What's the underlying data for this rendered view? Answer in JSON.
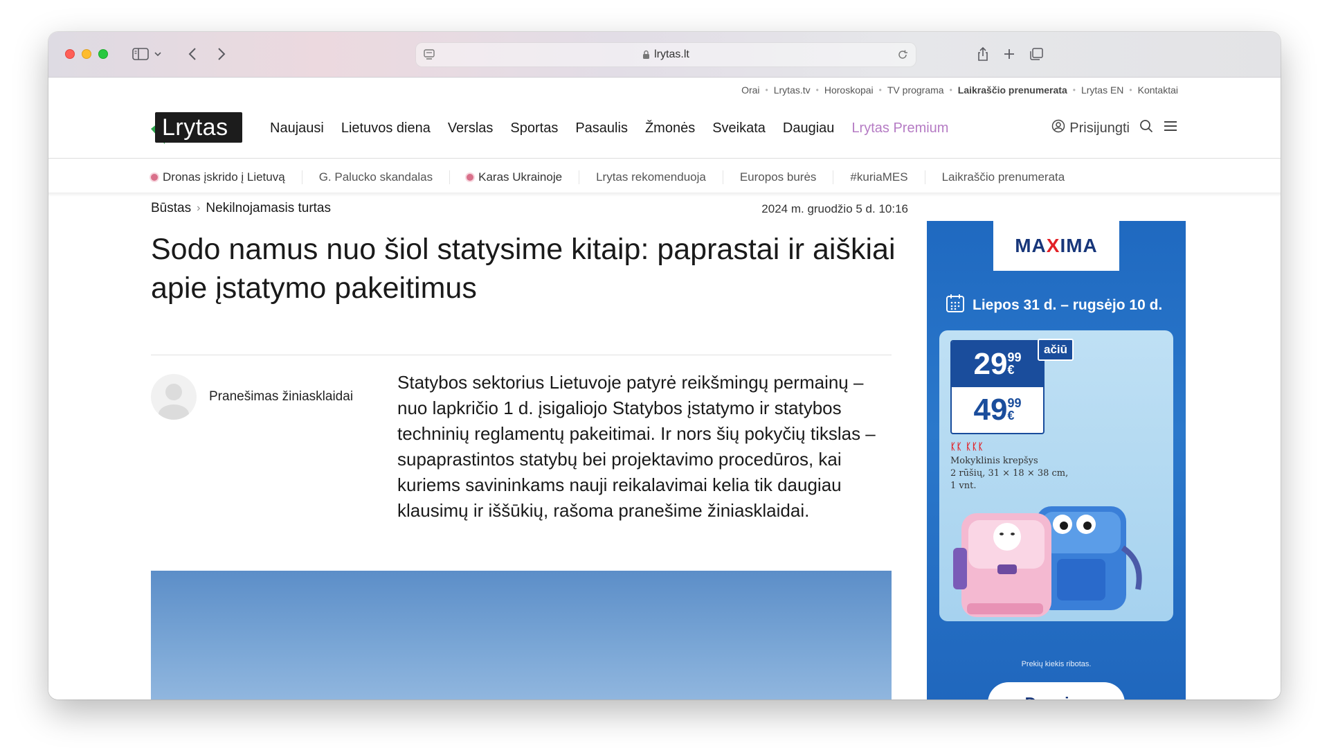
{
  "browser": {
    "url": "lrytas.lt"
  },
  "top_links": [
    "Orai",
    "Lrytas.tv",
    "Horoskopai",
    "TV programa",
    "Laikraščio prenumerata",
    "Lrytas EN",
    "Kontaktai"
  ],
  "logo": {
    "text": "Lrytas"
  },
  "main_nav": [
    "Naujausi",
    "Lietuvos diena",
    "Verslas",
    "Sportas",
    "Pasaulis",
    "Žmonės",
    "Sveikata",
    "Daugiau",
    "Lrytas Premium"
  ],
  "user": {
    "login_label": "Prisijungti"
  },
  "trending": [
    {
      "label": "Dronas įskrido į Lietuvą",
      "live": true
    },
    {
      "label": "G. Palucko skandalas",
      "live": false
    },
    {
      "label": "Karas Ukrainoje",
      "live": true
    },
    {
      "label": "Lrytas rekomenduoja",
      "live": false
    },
    {
      "label": "Europos burės",
      "live": false
    },
    {
      "label": "#kuriaMES",
      "live": false
    },
    {
      "label": "Laikraščio prenumerata",
      "live": false
    }
  ],
  "article": {
    "breadcrumb": [
      "Būstas",
      "Nekilnojamasis turtas"
    ],
    "date": "2024 m. gruodžio 5 d. 10:16",
    "headline": "Sodo namus nuo šiol statysime kitaip: paprastai ir aiškiai apie įstatymo pakeitimus",
    "author": "Pranešimas žiniasklaidai",
    "lead": "Statybos sektorius Lietuvoje patyrė reikšmingų permainų – nuo lapkričio 1 d. įsigaliojo Statybos įstatymo ir statybos techninių reglamentų pakeitimai. Ir nors šių pokyčių tikslas – supaprastintos statybų bei projektavimo procedūros, kai kuriems savininkams nauji reikalavimai kelia tik daugiau klausimų ir iššūkių, rašoma pranešime žiniasklaidai."
  },
  "ad": {
    "brand_left": "MA",
    "brand_x": "X",
    "brand_right": "IMA",
    "dates": "Liepos 31 d. – rugsėjo 10 d.",
    "price_new_main": "29",
    "price_new_cents": "99",
    "price_old_main": "49",
    "price_old_cents": "99",
    "currency": "€",
    "badge": "ačiū",
    "product_line1": "Mokyklinis krepšys",
    "product_line2": "2 rūšių, 31 × 18 × 38 cm,",
    "product_line3": "1 vnt.",
    "note": "Prekių kiekis ribotas.",
    "button": "Daugiau",
    "colors": {
      "bg": "#2270c4",
      "brand": "#17367a",
      "accent": "#e22026"
    }
  },
  "colors": {
    "premium": "#b57bc4",
    "logo_green": "#2fa84f",
    "live_dot": "#d9708a"
  }
}
